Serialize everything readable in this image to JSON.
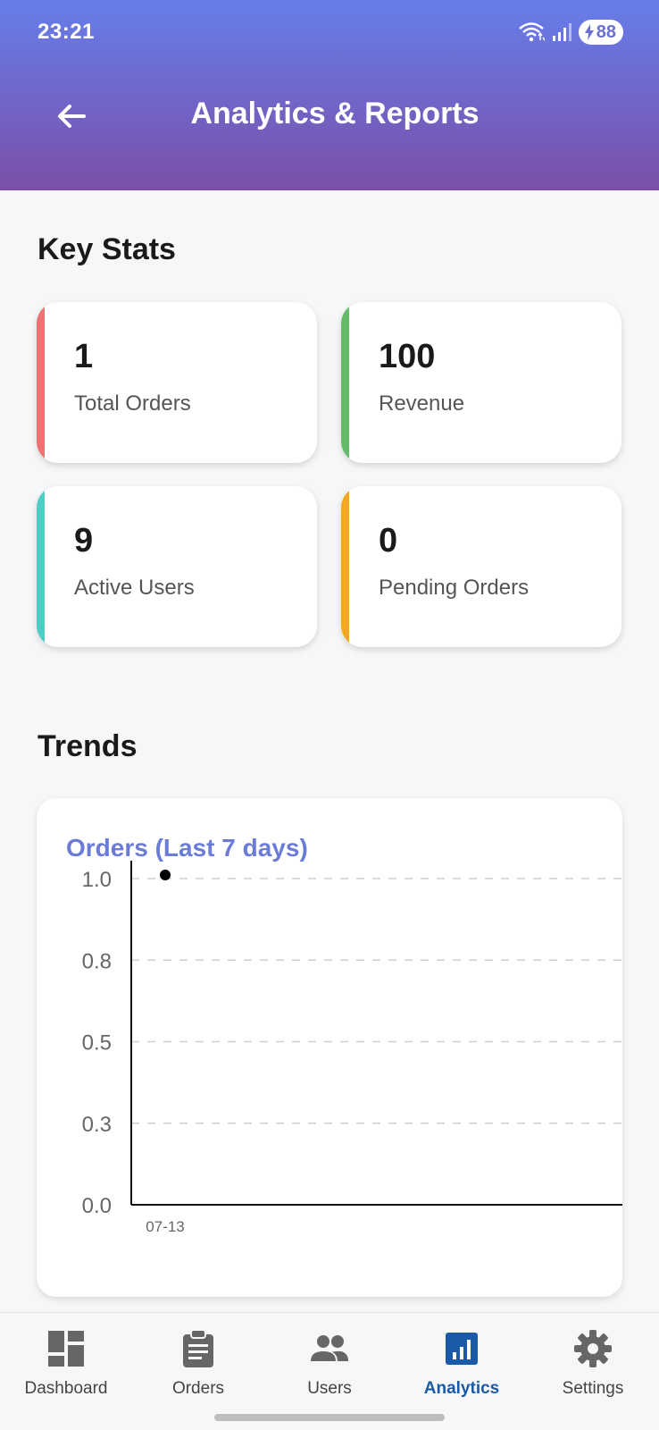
{
  "status_bar": {
    "time": "23:21",
    "battery": "88"
  },
  "header": {
    "title": "Analytics & Reports",
    "back_icon": "arrow-left-icon"
  },
  "key_stats": {
    "title": "Key Stats",
    "cards": [
      {
        "value": "1",
        "label": "Total Orders",
        "accent": "#f07171"
      },
      {
        "value": "100",
        "label": "Revenue",
        "accent": "#66bb6a"
      },
      {
        "value": "9",
        "label": "Active Users",
        "accent": "#4ecdc4"
      },
      {
        "value": "0",
        "label": "Pending Orders",
        "accent": "#f5a623"
      }
    ]
  },
  "trends": {
    "title": "Trends",
    "chart_title": "Orders (Last 7 days)"
  },
  "chart_data": {
    "type": "scatter",
    "title": "Orders (Last 7 days)",
    "x": [
      "07-13"
    ],
    "y": [
      1
    ],
    "y_ticks": [
      "0.0",
      "0.3",
      "0.5",
      "0.8",
      "1.0"
    ],
    "ylim": [
      0,
      1
    ],
    "grid": true,
    "point_color": "#000000"
  },
  "bottom_nav": {
    "items": [
      {
        "label": "Dashboard",
        "icon": "dashboard-icon",
        "active": false
      },
      {
        "label": "Orders",
        "icon": "clipboard-icon",
        "active": false
      },
      {
        "label": "Users",
        "icon": "users-icon",
        "active": false
      },
      {
        "label": "Analytics",
        "icon": "analytics-icon",
        "active": true
      },
      {
        "label": "Settings",
        "icon": "gear-icon",
        "active": false
      }
    ]
  },
  "colors": {
    "header_start": "#667eea",
    "header_end": "#7a4fa8",
    "active_nav": "#1a5aa6"
  }
}
